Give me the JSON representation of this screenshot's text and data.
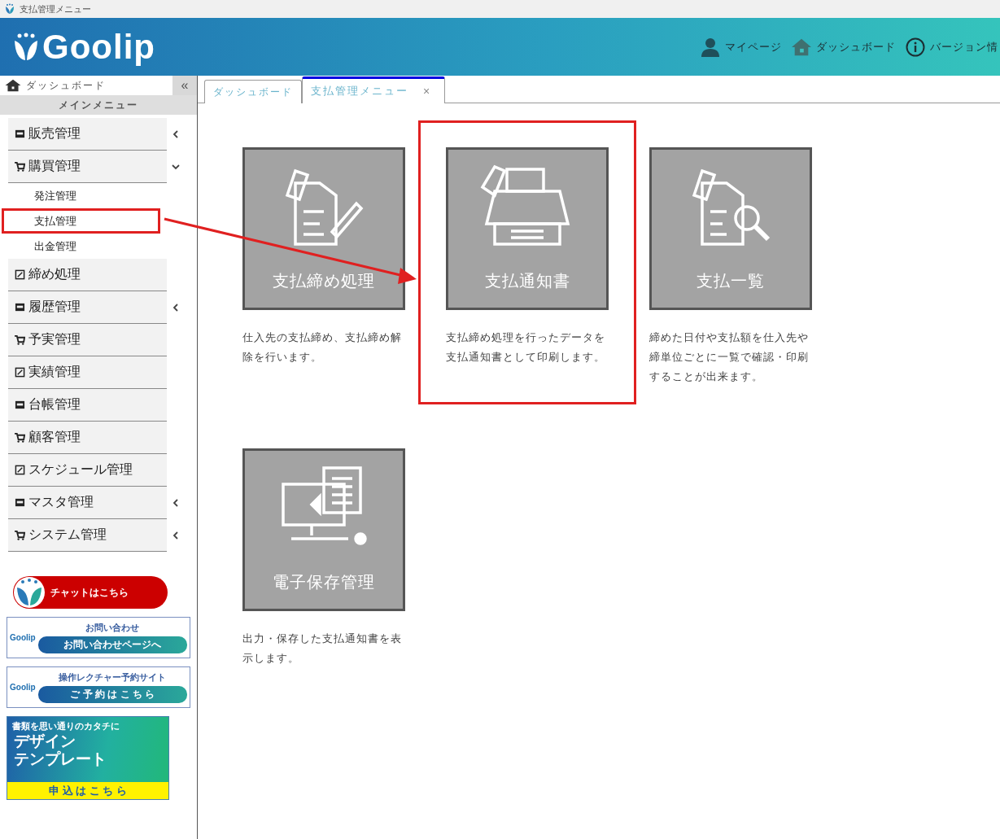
{
  "window": {
    "title": "支払管理メニュー"
  },
  "header": {
    "logo": "Goolip",
    "nav": [
      "マイページ",
      "ダッシュボード",
      "バージョン情"
    ]
  },
  "sidebar": {
    "home": "ダッシュボード",
    "collapse": "«",
    "section": "メインメニュー",
    "items": [
      {
        "label": "販売管理",
        "kind": "group",
        "expanded": false
      },
      {
        "label": "購買管理",
        "kind": "group",
        "expanded": true,
        "children": [
          {
            "label": "発注管理",
            "highlighted": false
          },
          {
            "label": "支払管理",
            "highlighted": true
          },
          {
            "label": "出金管理",
            "highlighted": false
          }
        ]
      },
      {
        "label": "締め処理",
        "kind": "link"
      },
      {
        "label": "履歴管理",
        "kind": "group",
        "expanded": false
      },
      {
        "label": "予実管理",
        "kind": "link"
      },
      {
        "label": "実績管理",
        "kind": "link"
      },
      {
        "label": "台帳管理",
        "kind": "link"
      },
      {
        "label": "顧客管理",
        "kind": "link"
      },
      {
        "label": "スケジュール管理",
        "kind": "link"
      },
      {
        "label": "マスタ管理",
        "kind": "group",
        "expanded": false
      },
      {
        "label": "システム管理",
        "kind": "group",
        "expanded": false
      }
    ],
    "banners": {
      "chat": "チャットはこちら",
      "contact": {
        "brand": "Goolip",
        "title": "お問い合わせ",
        "button": "お問い合わせページへ"
      },
      "lecture": {
        "brand": "Goolip",
        "title": "操作レクチャー予約サイト",
        "button": "ご 予 約 は こ ち ら"
      },
      "template": {
        "tagline": "書類を思い通りのカタチに",
        "title_1": "デザイン",
        "title_2": "テンプレート",
        "button": "申 込 は こ ち ら"
      }
    }
  },
  "tabs": [
    {
      "label": "ダッシュボード",
      "selected": false,
      "closable": false
    },
    {
      "label": "支払管理メニュー",
      "selected": true,
      "closable": true,
      "close": "×"
    }
  ],
  "cards": [
    {
      "title": "支払締め処理",
      "description": "仕入先の支払締め、支払締め解除を行います。",
      "highlighted": false
    },
    {
      "title": "支払通知書",
      "description": "支払締め処理を行ったデータを支払通知書として印刷します。",
      "highlighted": true
    },
    {
      "title": "支払一覧",
      "description": "締めた日付や支払額を仕入先や締単位ごとに一覧で確認・印刷することが出来ます。",
      "highlighted": false
    },
    {
      "title": "電子保存管理",
      "description": "出力・保存した支払通知書を表示します。",
      "highlighted": false
    }
  ]
}
